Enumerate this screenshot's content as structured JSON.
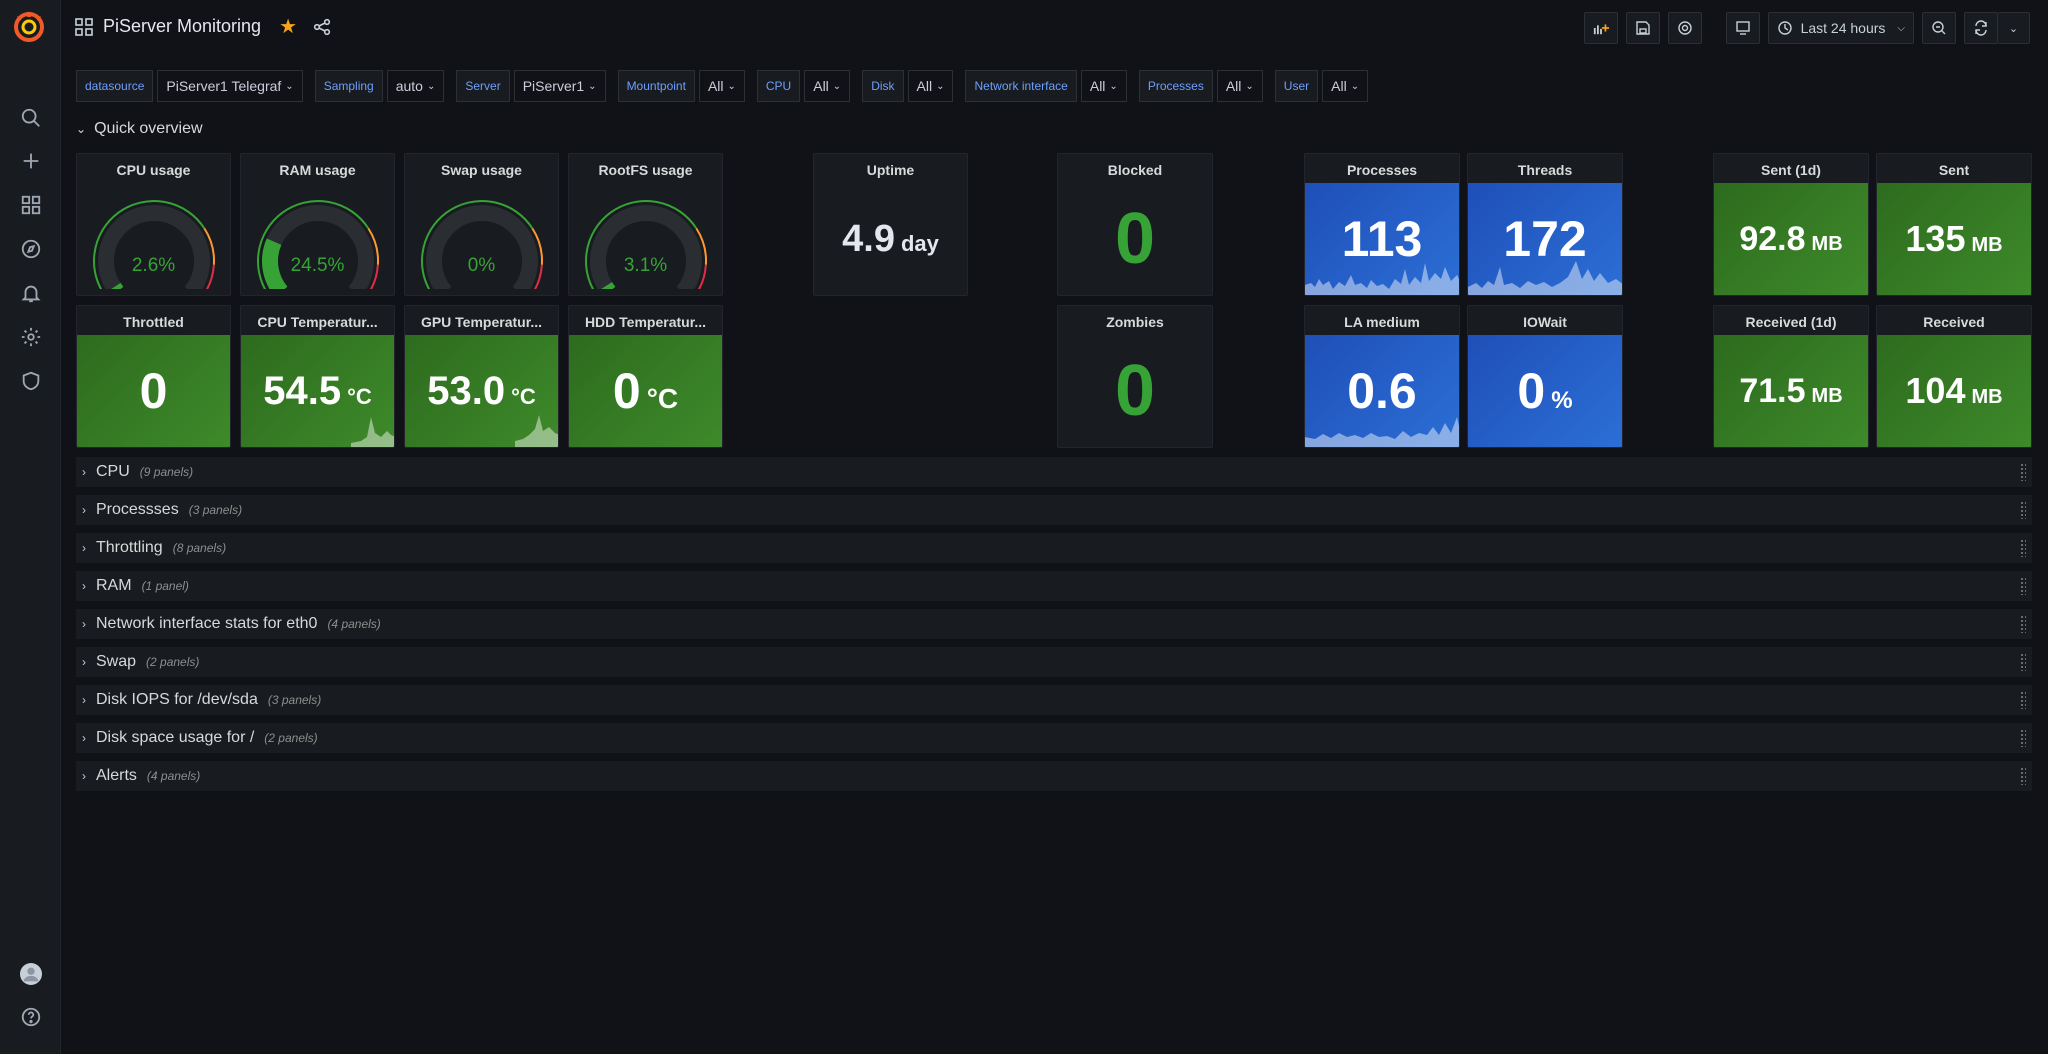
{
  "dashboard": {
    "title": "PiServer Monitoring"
  },
  "time_range": "Last 24 hours",
  "variables": [
    {
      "label": "datasource",
      "value": "PiServer1 Telegraf"
    },
    {
      "label": "Sampling",
      "value": "auto"
    },
    {
      "label": "Server",
      "value": "PiServer1"
    },
    {
      "label": "Mountpoint",
      "value": "All"
    },
    {
      "label": "CPU",
      "value": "All"
    },
    {
      "label": "Disk",
      "value": "All"
    },
    {
      "label": "Network interface",
      "value": "All"
    },
    {
      "label": "Processes",
      "value": "All"
    },
    {
      "label": "User",
      "value": "All"
    }
  ],
  "quick_overview": {
    "title": "Quick overview"
  },
  "gauges": [
    {
      "title": "CPU usage",
      "value": "2.6%",
      "percent": 2.6
    },
    {
      "title": "RAM usage",
      "value": "24.5%",
      "percent": 24.5
    },
    {
      "title": "Swap usage",
      "value": "0%",
      "percent": 0
    },
    {
      "title": "RootFS usage",
      "value": "3.1%",
      "percent": 3.1
    }
  ],
  "stats": {
    "uptime": {
      "title": "Uptime",
      "value": "4.9",
      "unit": "day"
    },
    "blocked": {
      "title": "Blocked",
      "value": "0"
    },
    "zombies": {
      "title": "Zombies",
      "value": "0"
    },
    "processes": {
      "title": "Processes",
      "value": "113"
    },
    "threads": {
      "title": "Threads",
      "value": "172"
    },
    "la_medium": {
      "title": "LA medium",
      "value": "0.6"
    },
    "iowait": {
      "title": "IOWait",
      "value": "0",
      "unit": "%"
    },
    "sent_1d": {
      "title": "Sent (1d)",
      "value": "92.8",
      "unit": "MB"
    },
    "sent": {
      "title": "Sent",
      "value": "135",
      "unit": "MB"
    },
    "received_1d": {
      "title": "Received (1d)",
      "value": "71.5",
      "unit": "MB"
    },
    "received": {
      "title": "Received",
      "value": "104",
      "unit": "MB"
    },
    "throttled": {
      "title": "Throttled",
      "value": "0"
    },
    "cpu_temp": {
      "title": "CPU Temperatur...",
      "value": "54.5",
      "unit": "°C"
    },
    "gpu_temp": {
      "title": "GPU Temperatur...",
      "value": "53.0",
      "unit": "°C"
    },
    "hdd_temp": {
      "title": "HDD Temperatur...",
      "value": "0",
      "unit": "°C"
    }
  },
  "rows": [
    {
      "title": "CPU",
      "count": "(9 panels)"
    },
    {
      "title": "Processses",
      "count": "(3 panels)"
    },
    {
      "title": "Throttling",
      "count": "(8 panels)"
    },
    {
      "title": "RAM",
      "count": "(1 panel)"
    },
    {
      "title": "Network interface stats for eth0",
      "count": "(4 panels)"
    },
    {
      "title": "Swap",
      "count": "(2 panels)"
    },
    {
      "title": "Disk IOPS for /dev/sda",
      "count": "(3 panels)"
    },
    {
      "title": "Disk space usage for /",
      "count": "(2 panels)"
    },
    {
      "title": "Alerts",
      "count": "(4 panels)"
    }
  ]
}
